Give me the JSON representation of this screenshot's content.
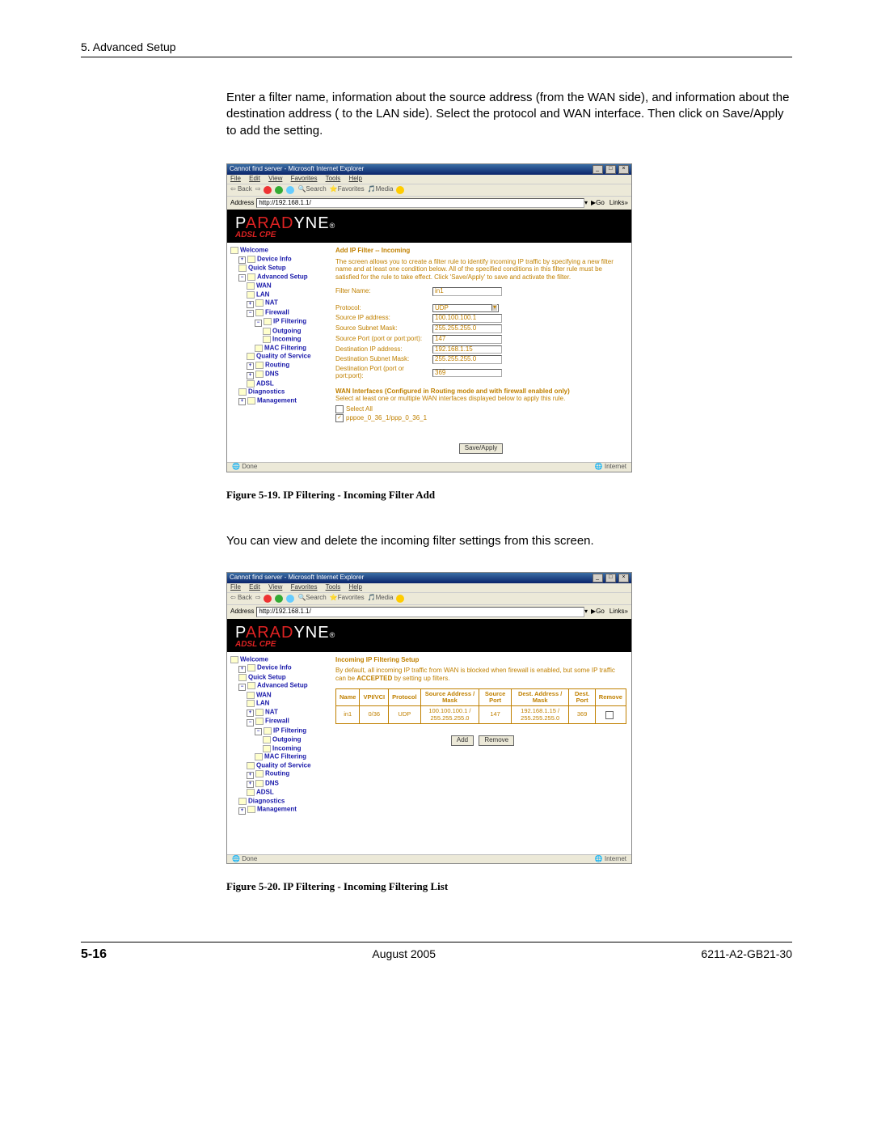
{
  "section_header": "5. Advanced Setup",
  "intro_text": "Enter a filter name, information about the source address (from the WAN side), and information about the destination address ( to the LAN side). Select the protocol and WAN interface. Then click on Save/Apply to add the setting.",
  "figure1_caption": "Figure 5-19.   IP Filtering - Incoming Filter Add",
  "para2": "You can view and delete the incoming filter settings from this screen.",
  "figure2_caption": "Figure 5-20.   IP Filtering - Incoming Filtering List",
  "footer": {
    "page": "5-16",
    "date": "August 2005",
    "doc": "6211-A2-GB21-30"
  },
  "ie": {
    "title": "Cannot find server - Microsoft Internet Explorer",
    "menu": [
      "File",
      "Edit",
      "View",
      "Favorites",
      "Tools",
      "Help"
    ],
    "toolbar": {
      "back": "Back",
      "search": "Search",
      "favorites": "Favorites",
      "media": "Media"
    },
    "addr_label": "Address",
    "addr_value": "http://192.168.1.1/",
    "go": "Go",
    "links": "Links",
    "status_left": "Done",
    "status_right": "Internet"
  },
  "brand": {
    "logo_part1": "P",
    "logo_part2": "ARAD",
    "logo_part3": "YNE",
    "reg": "®",
    "sub": "ADSL CPE"
  },
  "nav": {
    "welcome": "Welcome",
    "device_info": "Device Info",
    "quick_setup": "Quick Setup",
    "advanced_setup": "Advanced Setup",
    "wan": "WAN",
    "lan": "LAN",
    "nat": "NAT",
    "firewall": "Firewall",
    "ip_filtering": "IP Filtering",
    "outgoing": "Outgoing",
    "incoming": "Incoming",
    "mac_filtering": "MAC Filtering",
    "qos": "Quality of Service",
    "routing": "Routing",
    "dns": "DNS",
    "adsl": "ADSL",
    "diagnostics": "Diagnostics",
    "management": "Management"
  },
  "form1": {
    "title": "Add IP Filter -- Incoming",
    "desc": "The screen allows you to create a filter rule to identify incoming IP traffic by specifying a new filter name and at least one condition below. All of the specified conditions in this filter rule must be satisfied for the rule to take effect. Click 'Save/Apply' to save and activate the filter.",
    "labels": {
      "filter_name": "Filter Name:",
      "protocol": "Protocol:",
      "src_ip": "Source IP address:",
      "src_mask": "Source Subnet Mask:",
      "src_port": "Source Port (port or port:port):",
      "dst_ip": "Destination IP address:",
      "dst_mask": "Destination Subnet Mask:",
      "dst_port": "Destination Port (port or port:port):"
    },
    "values": {
      "filter_name": "in1",
      "protocol": "UDP",
      "src_ip": "100.100.100.1",
      "src_mask": "255.255.255.0",
      "src_port": "147",
      "dst_ip": "192.168.1.15",
      "dst_mask": "255.255.255.0",
      "dst_port": "369"
    },
    "wan_head": "WAN Interfaces (Configured in Routing mode and with firewall enabled only)",
    "wan_sub": "Select at least one or multiple WAN interfaces displayed below to apply this rule.",
    "select_all": "Select All",
    "wan_iface": "pppoe_0_36_1/ppp_0_36_1",
    "save": "Save/Apply"
  },
  "list2": {
    "title": "Incoming IP Filtering Setup",
    "desc_pre": "By default, all incoming IP traffic from WAN is blocked when firewall is enabled, but some IP traffic can be ",
    "desc_bold": "ACCEPTED",
    "desc_post": " by setting up filters.",
    "headers": {
      "name": "Name",
      "vpivci": "VPI/VCI",
      "protocol": "Protocol",
      "src": "Source Address / Mask",
      "sport": "Source Port",
      "dst": "Dest. Address / Mask",
      "dport": "Dest. Port",
      "remove": "Remove"
    },
    "row": {
      "name": "in1",
      "vpivci": "0/36",
      "protocol": "UDP",
      "src": "100.100.100.1 / 255.255.255.0",
      "sport": "147",
      "dst": "192.168.1.15 / 255.255.255.0",
      "dport": "369"
    },
    "add": "Add",
    "remove_btn": "Remove"
  }
}
